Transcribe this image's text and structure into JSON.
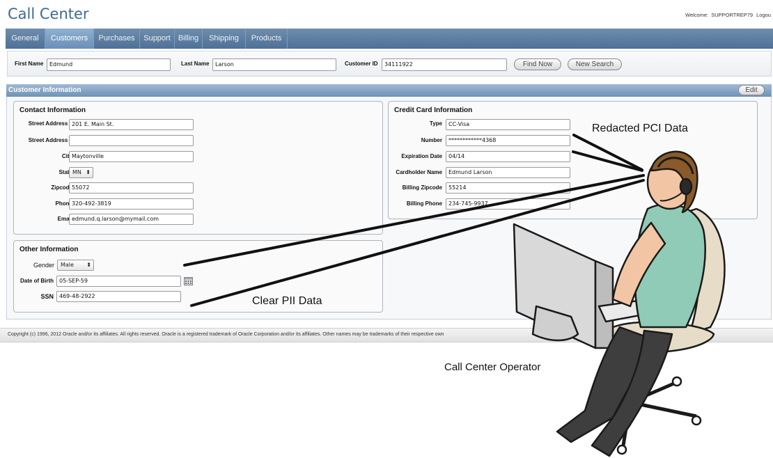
{
  "app": {
    "title": "Call Center",
    "welcome_label": "Welcome:",
    "user": "SUPPORTREP79",
    "logout_label": "Logou"
  },
  "tabs": [
    "General",
    "Customers",
    "Purchases",
    "Support",
    "Billing",
    "Shipping",
    "Products"
  ],
  "active_tab": "Customers",
  "search": {
    "first_name_label": "First Name",
    "first_name_value": "Edmund",
    "last_name_label": "Last Name",
    "last_name_value": "Larson",
    "customer_id_label": "Customer ID",
    "customer_id_value": "34111922",
    "find_button": "Find Now",
    "new_search_button": "New Search"
  },
  "customer_info": {
    "title": "Customer Information",
    "edit_button": "Edit"
  },
  "contact": {
    "title": "Contact Information",
    "street1_label": "Street Address 1",
    "street1_value": "201 E. Main St.",
    "street2_label": "Street Address 2",
    "street2_value": "",
    "city_label": "City",
    "city_value": "Maytonville",
    "state_label": "State",
    "state_value": "MN",
    "zip_label": "Zipcode",
    "zip_value": "55072",
    "phone_label": "Phone",
    "phone_value": "320-492-3819",
    "email_label": "Email",
    "email_value": "edmund.q.larson@mymail.com"
  },
  "credit_card": {
    "title": "Credit Card Information",
    "type_label": "Type",
    "type_value": "CC-Visa",
    "number_label": "Number",
    "number_value": "************4368",
    "exp_label": "Expiration Date",
    "exp_value": "04/14",
    "holder_label": "Cardholder Name",
    "holder_value": "Edmund Larson",
    "bzip_label": "Billing Zipcode",
    "bzip_value": "55214",
    "bphone_label": "Billing Phone",
    "bphone_value": "234-745-9937"
  },
  "other": {
    "title": "Other Information",
    "gender_label": "Gender",
    "gender_value": "Male",
    "dob_label": "Date of Birth",
    "dob_value": "05-SEP-59",
    "ssn_label": "SSN",
    "ssn_value": "469-48-2922"
  },
  "footer": {
    "text": "Copyright (c) 1996, 2012 Oracle and/or its affiliates. All rights reserved. Oracle is a registered trademark of Oracle Corporation and/or its affiliates. Other names may be trademarks of their respective own"
  },
  "annotations": {
    "pci": "Redacted PCI Data",
    "pii": "Clear PII Data",
    "operator": "Call Center Operator"
  },
  "colors": {
    "tab_bar": "#4f7096",
    "active_tab": "#7fa3c8",
    "header_blue": "#6f92b6",
    "title_blue": "#3d6a8f"
  },
  "icons": {
    "calendar": "calendar-icon",
    "select_arrows": "updown-arrows-icon"
  }
}
